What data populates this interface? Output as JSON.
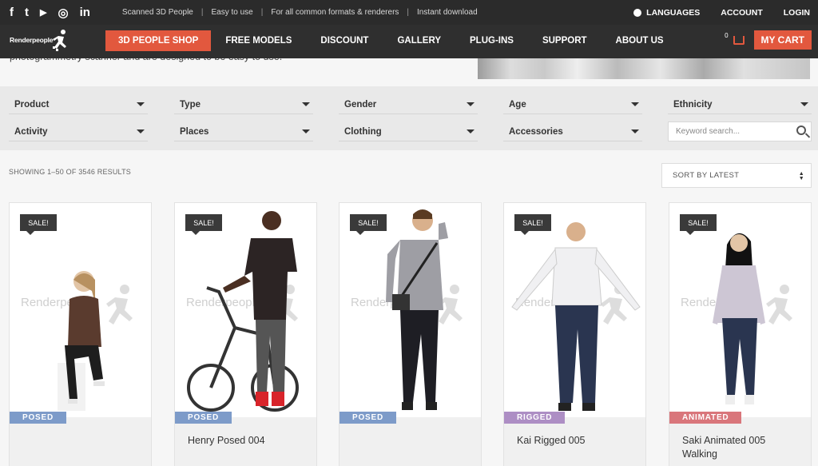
{
  "topbar": {
    "social": [
      {
        "icon": "facebook-icon",
        "glyph": "f"
      },
      {
        "icon": "twitter-icon",
        "glyph": "t"
      },
      {
        "icon": "youtube-icon",
        "glyph": "▶"
      },
      {
        "icon": "instagram-icon",
        "glyph": "◎"
      },
      {
        "icon": "linkedin-icon",
        "glyph": "in"
      }
    ],
    "taglines": [
      "Scanned 3D People",
      "Easy to use",
      "For all common formats & renderers",
      "Instant download"
    ],
    "languages": "LANGUAGES",
    "account": "ACCOUNT",
    "login": "LOGIN"
  },
  "nav": {
    "logo": "Renderpeople",
    "items": [
      "3D PEOPLE SHOP",
      "FREE MODELS",
      "DISCOUNT",
      "GALLERY",
      "PLUG-INS",
      "SUPPORT",
      "ABOUT US"
    ],
    "active_index": 0,
    "cart_count": "0",
    "cart_label": "MY CART"
  },
  "hero": {
    "text_fragment": "photogrammetry scanner and are designed to be easy to use."
  },
  "filters": [
    {
      "label": "Product"
    },
    {
      "label": "Type"
    },
    {
      "label": "Gender"
    },
    {
      "label": "Age"
    },
    {
      "label": "Ethnicity"
    },
    {
      "label": "Activity"
    },
    {
      "label": "Places"
    },
    {
      "label": "Clothing"
    },
    {
      "label": "Accessories"
    }
  ],
  "search": {
    "placeholder": "Keyword search..."
  },
  "results": {
    "text": "SHOWING 1–50 OF 3546 RESULTS"
  },
  "sort": {
    "value": "SORT BY LATEST"
  },
  "products": [
    {
      "sale": "SALE!",
      "watermark": "Renderpeople",
      "badge": "POSED",
      "badge_type": "posed",
      "title": ""
    },
    {
      "sale": "SALE!",
      "watermark": "Renderpeople",
      "badge": "POSED",
      "badge_type": "posed",
      "title": "Henry Posed 004"
    },
    {
      "sale": "SALE!",
      "watermark": "Renderpeople",
      "badge": "POSED",
      "badge_type": "posed",
      "title": ""
    },
    {
      "sale": "SALE!",
      "watermark": "Renderpeople",
      "badge": "RIGGED",
      "badge_type": "rigged",
      "title": "Kai Rigged 005"
    },
    {
      "sale": "SALE!",
      "watermark": "Renderpeople",
      "badge": "ANIMATED",
      "badge_type": "animated",
      "title": "Saki Animated 005 Walking"
    }
  ],
  "colors": {
    "accent": "#e2583e",
    "topbar": "#2b2b2b",
    "posed": "#7d9bc9",
    "rigged": "#ad8ec4",
    "animated": "#d9767b"
  }
}
